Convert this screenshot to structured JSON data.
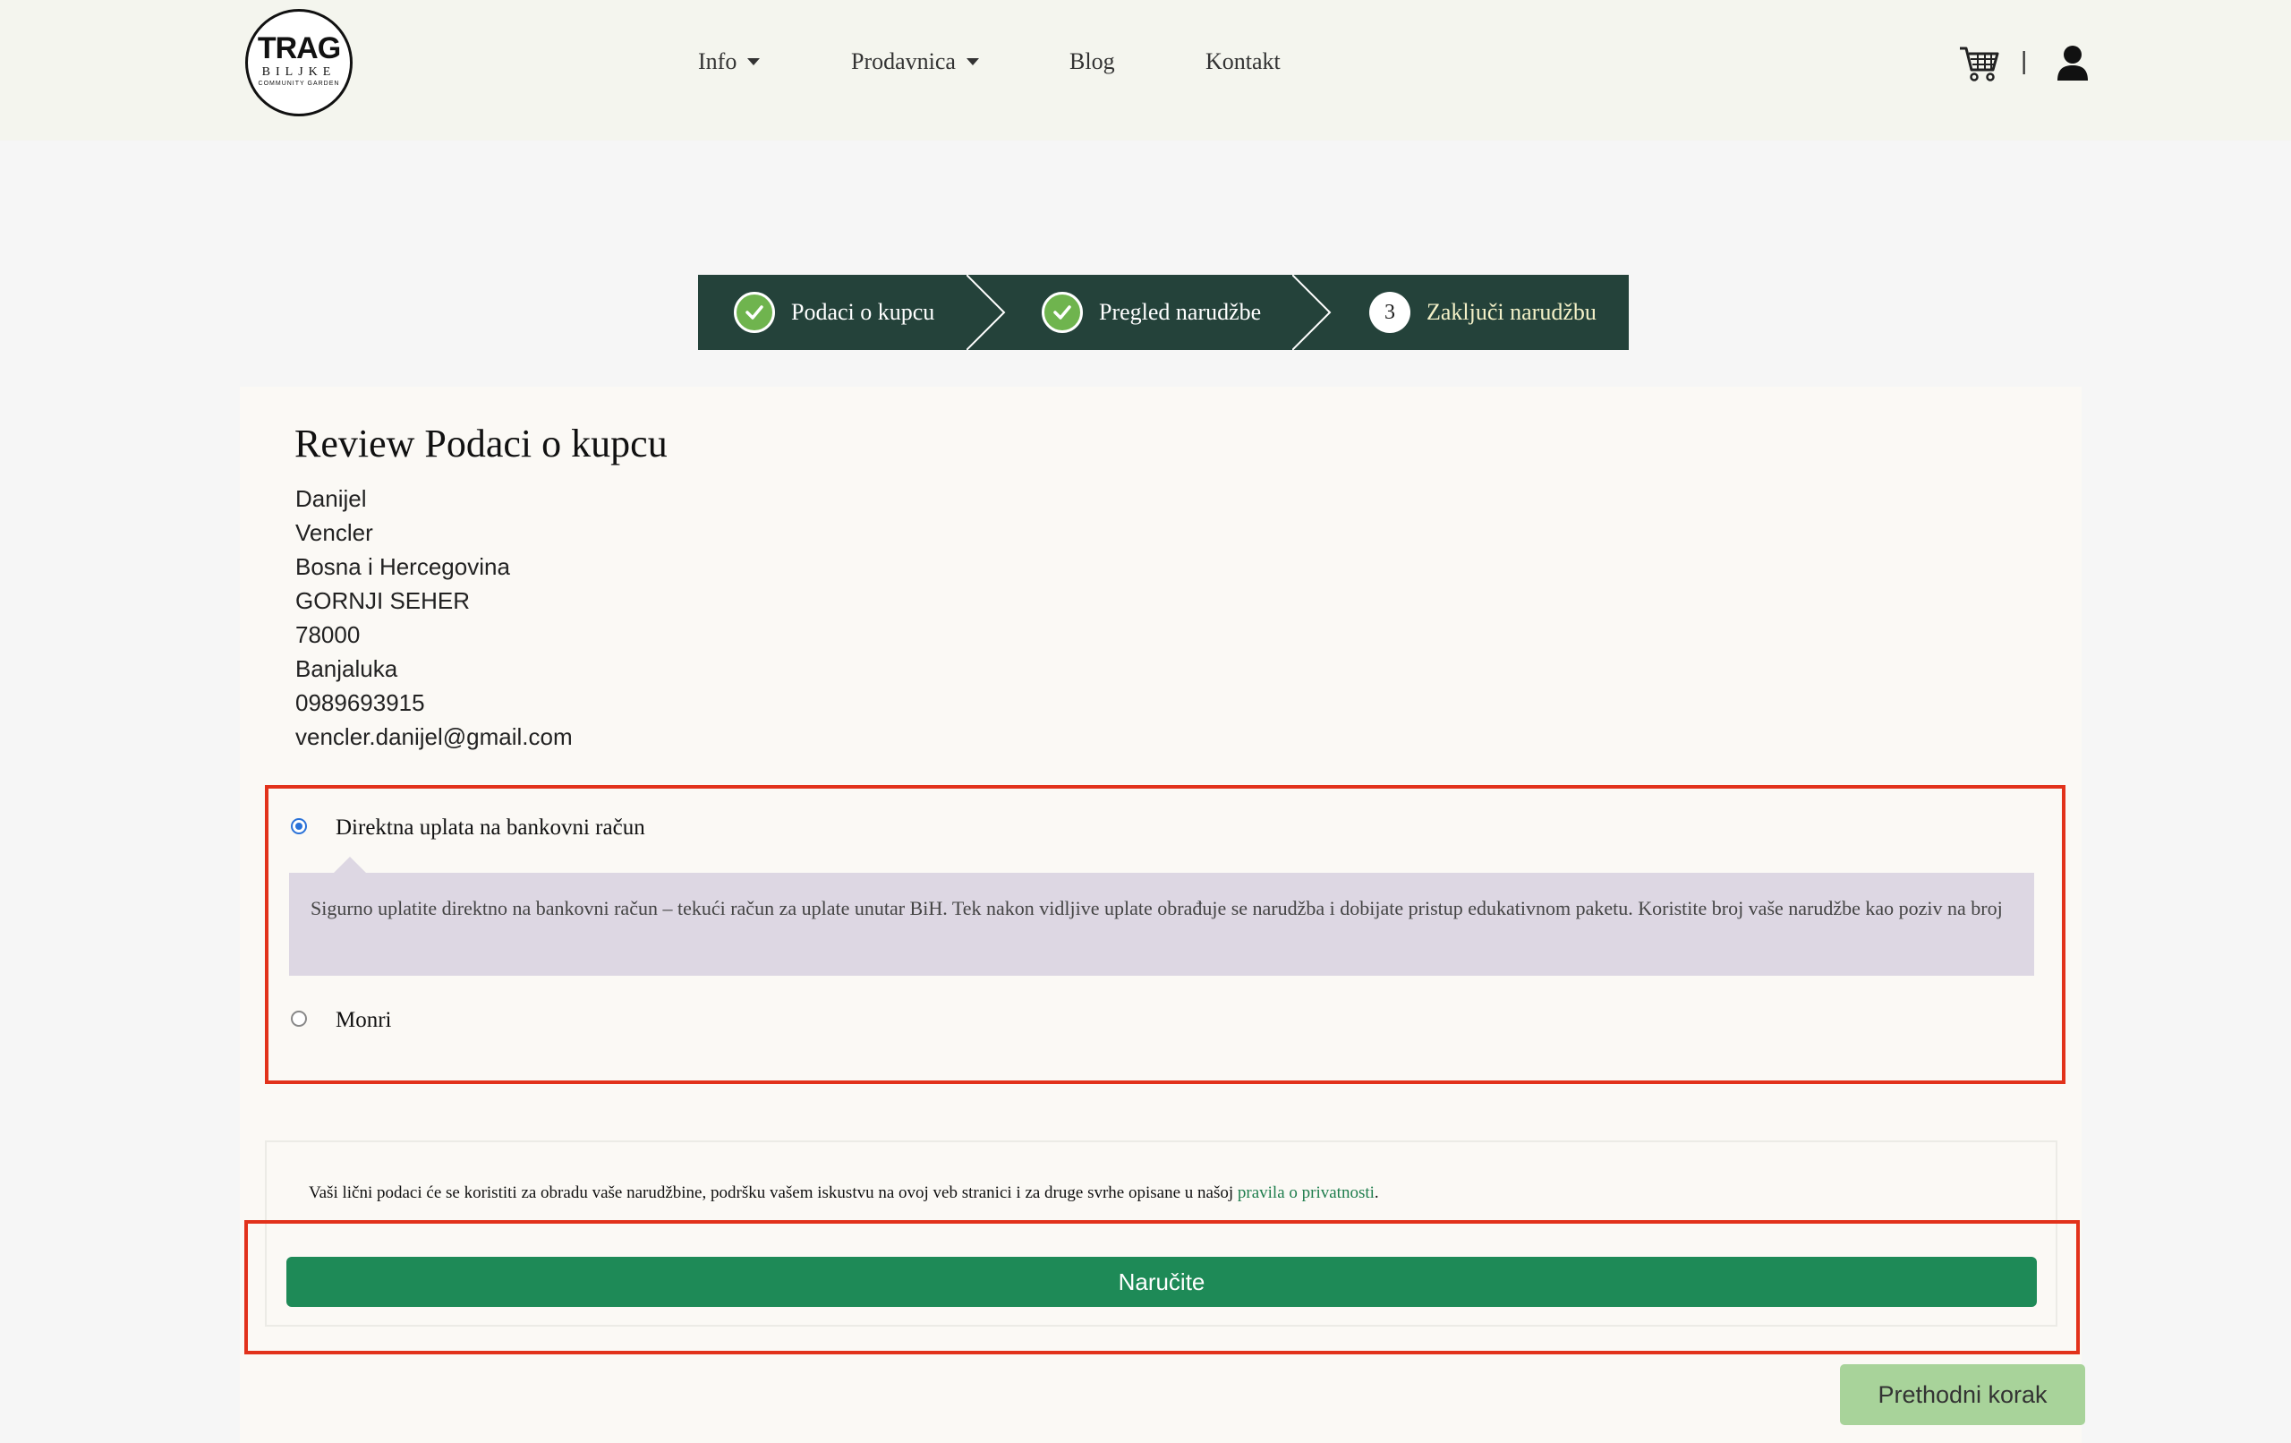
{
  "header": {
    "logo": {
      "big": "TRAG",
      "mid": "BILJKE",
      "small": "COMMUNITY GARDEN"
    },
    "nav": [
      {
        "label": "Info"
      },
      {
        "label": "Prodavnica"
      },
      {
        "label": "Blog"
      },
      {
        "label": "Kontakt"
      }
    ],
    "separator": "|",
    "icons": {
      "cart": "cart-icon",
      "user": "user-icon"
    }
  },
  "steps": [
    {
      "label": "Podaci o kupcu",
      "state": "done"
    },
    {
      "label": "Pregled narudžbe",
      "state": "done"
    },
    {
      "number": "3",
      "label": "Zaključi narudžbu",
      "state": "current"
    }
  ],
  "review": {
    "title": "Review Podaci o kupcu",
    "lines": [
      "Danijel",
      "Vencler",
      "Bosna i Hercegovina",
      "GORNJI SEHER",
      "78000",
      "Banjaluka",
      "0989693915",
      "vencler.danijel@gmail.com"
    ]
  },
  "payment": {
    "selected": "bank",
    "options": [
      {
        "id": "bank",
        "label": "Direktna uplata na bankovni račun"
      },
      {
        "id": "monri",
        "label": "Monri"
      }
    ],
    "description": "Sigurno uplatite direktno na bankovni račun – tekući račun za uplate unutar BiH. Tek nakon vidljive uplate obrađuje se narudžba i dobijate pristup edukativnom paketu. Koristite broj vaše narudžbe kao poziv na broj"
  },
  "privacy": {
    "text": "Vaši lični podaci će se koristiti za obradu vaše narudžbine, podršku vašem iskustvu na ovoj veb stranici i za druge svrhe opisane u našoj ",
    "link": "pravila o privatnosti",
    "end": "."
  },
  "buttons": {
    "order": "Naručite",
    "previous": "Prethodni korak"
  },
  "colors": {
    "header_bg": "#f4f5ee",
    "steps_bg": "#24423a",
    "check": "#6fb44e",
    "order": "#1e8a57",
    "previous": "#a8d39a",
    "highlight": "#e2321b"
  }
}
